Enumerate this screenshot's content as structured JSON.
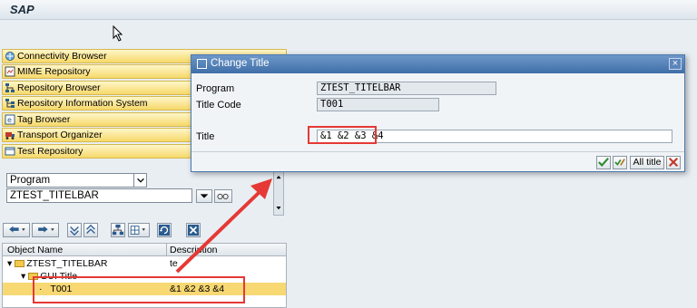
{
  "app": {
    "title": "SAP"
  },
  "nav": {
    "items": [
      {
        "label": "Connectivity Browser",
        "icon": "connectivity-icon"
      },
      {
        "label": "MIME Repository",
        "icon": "mime-icon"
      },
      {
        "label": "Repository Browser",
        "icon": "repository-icon"
      },
      {
        "label": "Repository Information System",
        "icon": "info-system-icon"
      },
      {
        "label": "Tag Browser",
        "icon": "tag-icon"
      },
      {
        "label": "Transport Organizer",
        "icon": "truck-icon"
      },
      {
        "label": "Test Repository",
        "icon": "test-icon"
      }
    ],
    "object_type": "Program",
    "object_name": "ZTEST_TITELBAR"
  },
  "tree": {
    "headers": [
      "Object Name",
      "Description"
    ],
    "rows": [
      {
        "name": "ZTEST_TITELBAR",
        "desc": "te"
      },
      {
        "name": "GUI Title",
        "desc": ""
      },
      {
        "name": "T001",
        "desc": "&1 &2 &3 &4"
      }
    ]
  },
  "dialog": {
    "title": "Change Title",
    "program_label": "Program",
    "program_value": "ZTEST_TITELBAR",
    "title_code_label": "Title Code",
    "title_code_value": "T001",
    "title_label": "Title",
    "title_value": "&1 &2 &3 &4",
    "all_title_button": "All title"
  },
  "colors": {
    "highlight": "#e53935",
    "selection": "#f7d873",
    "nav_tab": "#f6d96a",
    "dialog_header": "#3f6ea8"
  }
}
